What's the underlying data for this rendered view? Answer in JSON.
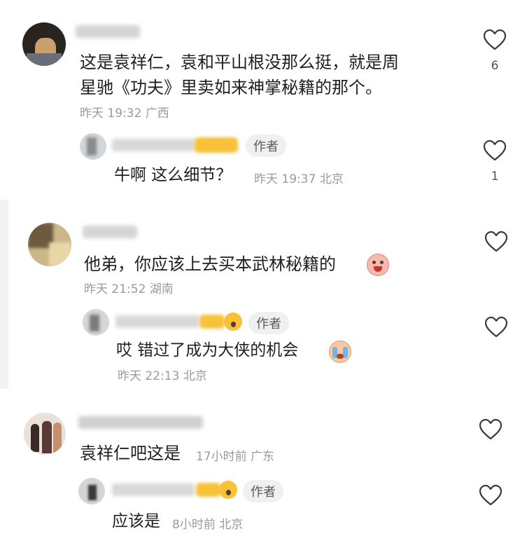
{
  "comments": [
    {
      "text_line1": "这是袁祥仁，袁和平山根没那么挺，就是周",
      "text_line2": "星驰《功夫》里卖如来神掌秘籍的那个。",
      "time": "昨天 19:32",
      "location": "广西",
      "likes": "6",
      "reply": {
        "badge": "作者",
        "text": "牛啊 这么细节？",
        "time": "昨天 19:37",
        "location": "北京",
        "likes": "1"
      }
    },
    {
      "text": "他弟，你应该上去买本武林秘籍的",
      "time": "昨天 21:52",
      "location": "湖南",
      "likes": "",
      "reply": {
        "badge": "作者",
        "text": "哎 错过了成为大侠的机会",
        "time": "昨天 22:13",
        "location": "北京",
        "likes": ""
      }
    },
    {
      "text": "袁祥仁吧这是",
      "time": "17小时前",
      "location": "广东",
      "likes": "",
      "reply": {
        "badge": "作者",
        "text": "应该是",
        "time": "8小时前",
        "location": "北京",
        "likes": ""
      }
    }
  ],
  "colors": {
    "heart": "#3a3a3a",
    "meta_text": "#9a9a9a",
    "badge_bg": "#f0f0f0",
    "emoji_yellow": "#f7c23a"
  }
}
